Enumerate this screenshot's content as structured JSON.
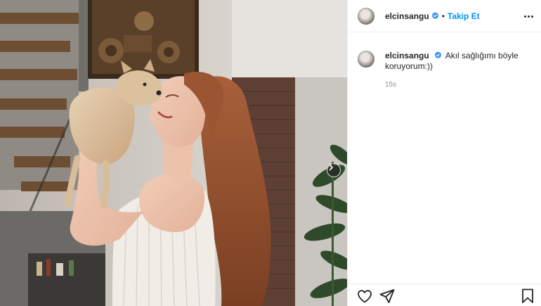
{
  "post": {
    "username": "elcinsangu",
    "verified": true,
    "follow_label": "Takip Et",
    "separator": "•",
    "caption": "Akıl sağlığımı böyle koruyorum:))",
    "time_ago": "15s"
  },
  "icons": {
    "next": "chevron-right-icon",
    "more": "more-options-icon",
    "like": "heart-icon",
    "share": "paper-plane-icon",
    "save": "bookmark-icon",
    "verified": "verified-badge-icon"
  },
  "colors": {
    "accent": "#0095f6",
    "verified": "#3897f0",
    "text": "#262626",
    "muted": "#8e8e8e",
    "divider": "#efefef"
  }
}
